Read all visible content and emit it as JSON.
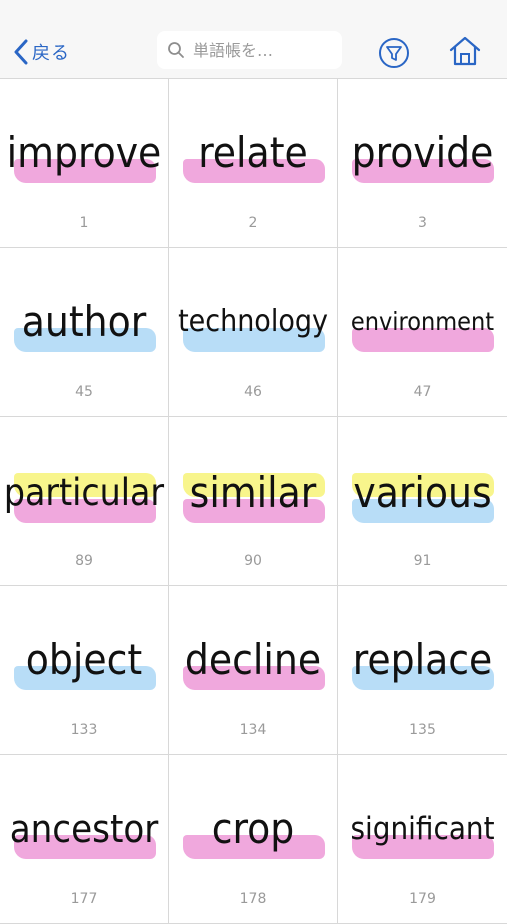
{
  "header": {
    "back_label": "戻る",
    "search_placeholder": "単語帳を…",
    "icons": [
      "chevron-left-icon",
      "search-icon",
      "filter-icon",
      "home-icon"
    ]
  },
  "colors": {
    "accent": "#2a66c5",
    "pink": "#f0a8dd",
    "blue": "#b8ddf7",
    "yellow": "#f8f58c"
  },
  "cards": [
    {
      "word": "improve",
      "number": "1",
      "highlights": [
        "pink"
      ]
    },
    {
      "word": "relate",
      "number": "2",
      "highlights": [
        "pink"
      ]
    },
    {
      "word": "provide",
      "number": "3",
      "highlights": [
        "pink"
      ]
    },
    {
      "word": "author",
      "number": "45",
      "highlights": [
        "blue"
      ]
    },
    {
      "word": "technology",
      "number": "46",
      "highlights": [
        "blue"
      ]
    },
    {
      "word": "environment",
      "number": "47",
      "highlights": [
        "pink"
      ]
    },
    {
      "word": "particular",
      "number": "89",
      "highlights": [
        "yellow",
        "pink"
      ]
    },
    {
      "word": "similar",
      "number": "90",
      "highlights": [
        "yellow",
        "pink"
      ]
    },
    {
      "word": "various",
      "number": "91",
      "highlights": [
        "yellow",
        "blue"
      ]
    },
    {
      "word": "object",
      "number": "133",
      "highlights": [
        "blue"
      ]
    },
    {
      "word": "decline",
      "number": "134",
      "highlights": [
        "pink"
      ]
    },
    {
      "word": "replace",
      "number": "135",
      "highlights": [
        "blue"
      ]
    },
    {
      "word": "ancestor",
      "number": "177",
      "highlights": [
        "pink"
      ]
    },
    {
      "word": "crop",
      "number": "178",
      "highlights": [
        "pink"
      ]
    },
    {
      "word": "significant",
      "number": "179",
      "highlights": [
        "pink"
      ]
    }
  ]
}
